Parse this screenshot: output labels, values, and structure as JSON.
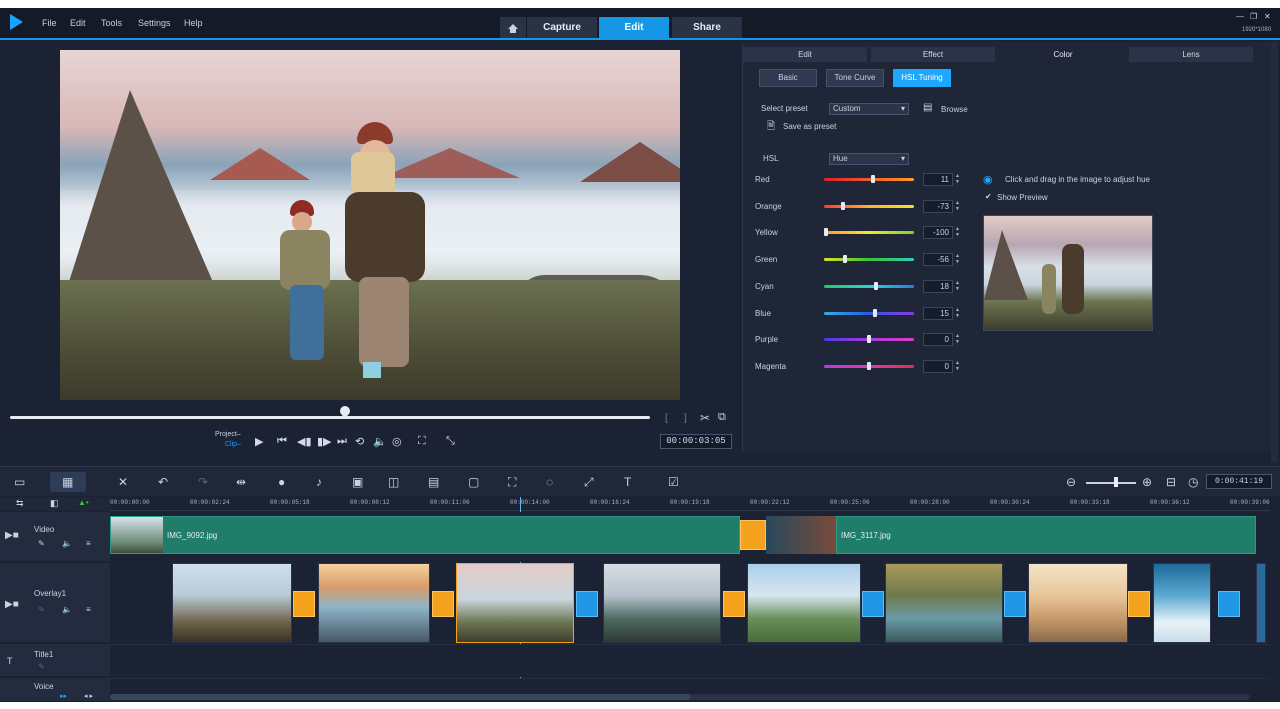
{
  "menu": [
    "File",
    "Edit",
    "Tools",
    "Settings",
    "Help"
  ],
  "main_tabs": [
    {
      "label": "Capture"
    },
    {
      "label": "Edit",
      "active": true
    },
    {
      "label": "Share"
    }
  ],
  "window_size_label": "1920*1080",
  "player": {
    "project_label": "Project–",
    "clip_label": "Clip–",
    "timecode": "00:00:03:05"
  },
  "right_panel": {
    "tabs": [
      "Edit",
      "Effect",
      "Color",
      "Lens"
    ],
    "active_tab": "Color",
    "subtabs": [
      "Basic",
      "Tone Curve",
      "HSL Tuning"
    ],
    "active_subtab": "HSL Tuning",
    "select_preset_label": "Select preset",
    "preset_value": "Custom",
    "browse_label": "Browse",
    "save_preset_label": "Save as preset",
    "hsl_label": "HSL",
    "hsl_mode": "Hue",
    "hint": "Click and drag in the image to adjust hue",
    "show_preview": "Show Preview",
    "sliders": [
      {
        "name": "Red",
        "value": "11",
        "pos": 0.55,
        "gradient": "linear-gradient(90deg,#e01d2d,#ff9a2a)"
      },
      {
        "name": "Orange",
        "value": "-73",
        "pos": 0.2,
        "gradient": "linear-gradient(90deg,#ff3b2a,#ffb42a,#f2e12a)"
      },
      {
        "name": "Yellow",
        "value": "-100",
        "pos": 0.0,
        "gradient": "linear-gradient(90deg,#ff9a2a,#f7e52a,#7ed12a)"
      },
      {
        "name": "Green",
        "value": "-56",
        "pos": 0.22,
        "gradient": "linear-gradient(90deg,#d9e22a,#3ac23a,#2ad2b4)"
      },
      {
        "name": "Cyan",
        "value": "18",
        "pos": 0.58,
        "gradient": "linear-gradient(90deg,#2ac86a,#2ad2d2,#2a7ee2)"
      },
      {
        "name": "Blue",
        "value": "15",
        "pos": 0.57,
        "gradient": "linear-gradient(90deg,#2ab4e2,#2a5ae2,#8a3ae2)"
      },
      {
        "name": "Purple",
        "value": "0",
        "pos": 0.5,
        "gradient": "linear-gradient(90deg,#4a3ae2,#a83ae2,#e23ac8)"
      },
      {
        "name": "Magenta",
        "value": "0",
        "pos": 0.5,
        "gradient": "linear-gradient(90deg,#b43ae2,#e23aa8,#e22a5a)"
      }
    ]
  },
  "timeline": {
    "ruler_ticks": [
      "00:00:00:00",
      "00:00:02:24",
      "00:00:05:18",
      "00:00:08:12",
      "00:00:11:06",
      "00:00:14:00",
      "00:00:16:24",
      "00:00:19:18",
      "00:00:22:12",
      "00:00:25:06",
      "00:00:28:00",
      "00:00:30:24",
      "00:00:33:18",
      "00:00:36:12",
      "00:00:39:06"
    ],
    "zoom_timecode": "0:00:41:19",
    "tracks": [
      {
        "label": "Video"
      },
      {
        "label": "Overlay1"
      },
      {
        "label": "Title1"
      },
      {
        "label": "Voice"
      }
    ],
    "video_clips": [
      "IMG_9092.jpg",
      "IMG_3117.jpg"
    ]
  }
}
